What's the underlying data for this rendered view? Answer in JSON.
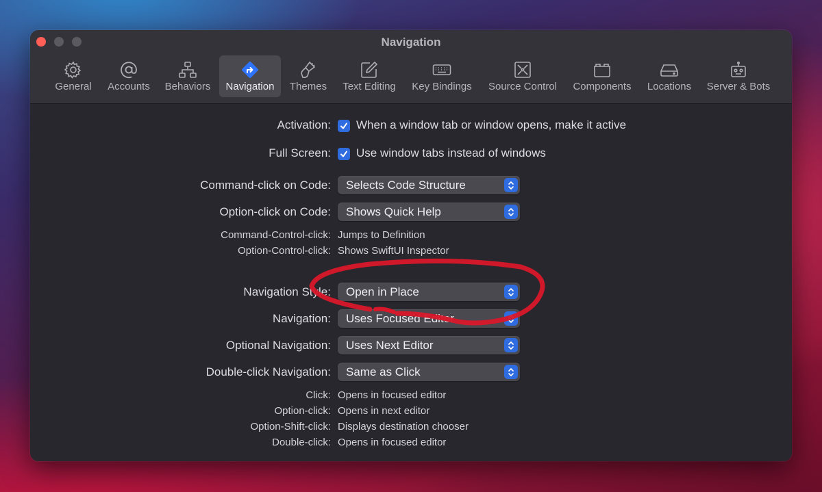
{
  "window": {
    "title": "Navigation"
  },
  "toolbar": {
    "items": [
      {
        "label": "General",
        "icon": "gear-icon"
      },
      {
        "label": "Accounts",
        "icon": "at-icon"
      },
      {
        "label": "Behaviors",
        "icon": "hierarchy-icon"
      },
      {
        "label": "Navigation",
        "icon": "navigation-arrow-icon",
        "active": true
      },
      {
        "label": "Themes",
        "icon": "paintbrush-icon"
      },
      {
        "label": "Text Editing",
        "icon": "pencil-square-icon"
      },
      {
        "label": "Key Bindings",
        "icon": "keyboard-icon"
      },
      {
        "label": "Source Control",
        "icon": "source-control-icon"
      },
      {
        "label": "Components",
        "icon": "components-icon"
      },
      {
        "label": "Locations",
        "icon": "drive-icon"
      },
      {
        "label": "Server & Bots",
        "icon": "robot-icon"
      }
    ]
  },
  "settings": {
    "activation": {
      "label": "Activation:",
      "text": "When a window tab or window opens, make it active",
      "checked": true
    },
    "full_screen": {
      "label": "Full Screen:",
      "text": "Use window tabs instead of windows",
      "checked": true
    },
    "command_click": {
      "label": "Command-click on Code:",
      "value": "Selects Code Structure"
    },
    "option_click": {
      "label": "Option-click on Code:",
      "value": "Shows Quick Help"
    },
    "command_control_click": {
      "label": "Command-Control-click:",
      "value": "Jumps to Definition"
    },
    "option_control_click": {
      "label": "Option-Control-click:",
      "value": "Shows SwiftUI Inspector"
    },
    "navigation_style": {
      "label": "Navigation Style:",
      "value": "Open in Place"
    },
    "navigation": {
      "label": "Navigation:",
      "value": "Uses Focused Editor"
    },
    "optional_navigation": {
      "label": "Optional Navigation:",
      "value": "Uses Next Editor"
    },
    "double_click_navigation": {
      "label": "Double-click Navigation:",
      "value": "Same as Click"
    },
    "summary": [
      {
        "label": "Click:",
        "value": "Opens in focused editor"
      },
      {
        "label": "Option-click:",
        "value": "Opens in next editor"
      },
      {
        "label": "Option-Shift-click:",
        "value": "Displays destination chooser"
      },
      {
        "label": "Double-click:",
        "value": "Opens in focused editor"
      }
    ]
  },
  "colors": {
    "accent": "#2f6ce0",
    "annotation": "#d8182a",
    "window_bg": "#28272d"
  }
}
